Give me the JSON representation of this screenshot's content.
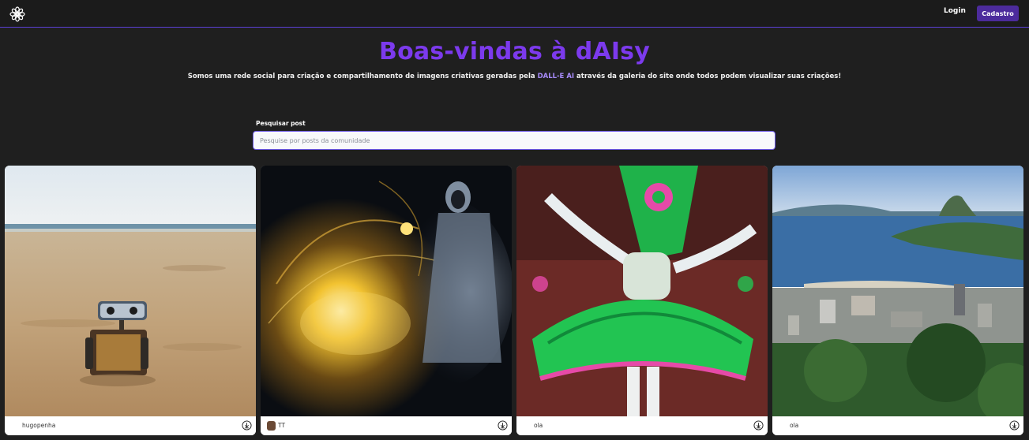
{
  "nav": {
    "logo_icon": "flower-logo-icon",
    "login_label": "Login",
    "signup_label": "Cadastro",
    "accent": "#7c3aed"
  },
  "hero": {
    "title": "Boas-vindas à dAIsy",
    "subtitle_before": "Somos uma rede social para criação e compartilhamento de imagens criativas geradas pela ",
    "subtitle_highlight": "DALL-E AI",
    "subtitle_after": " através da galeria do site onde todos podem visualizar suas criações!"
  },
  "search": {
    "label": "Pesquisar post",
    "placeholder": "Pesquise por posts da comunidade",
    "value": ""
  },
  "posts": [
    {
      "author": "hugopenha",
      "image": "robot-on-beach",
      "download_icon": "download-icon"
    },
    {
      "author": "TT",
      "image": "cosmic-wizard",
      "download_icon": "download-icon"
    },
    {
      "author": "ola",
      "image": "carnival-dancer",
      "download_icon": "download-icon"
    },
    {
      "author": "ola",
      "image": "rio-de-janeiro-view",
      "download_icon": "download-icon"
    }
  ]
}
